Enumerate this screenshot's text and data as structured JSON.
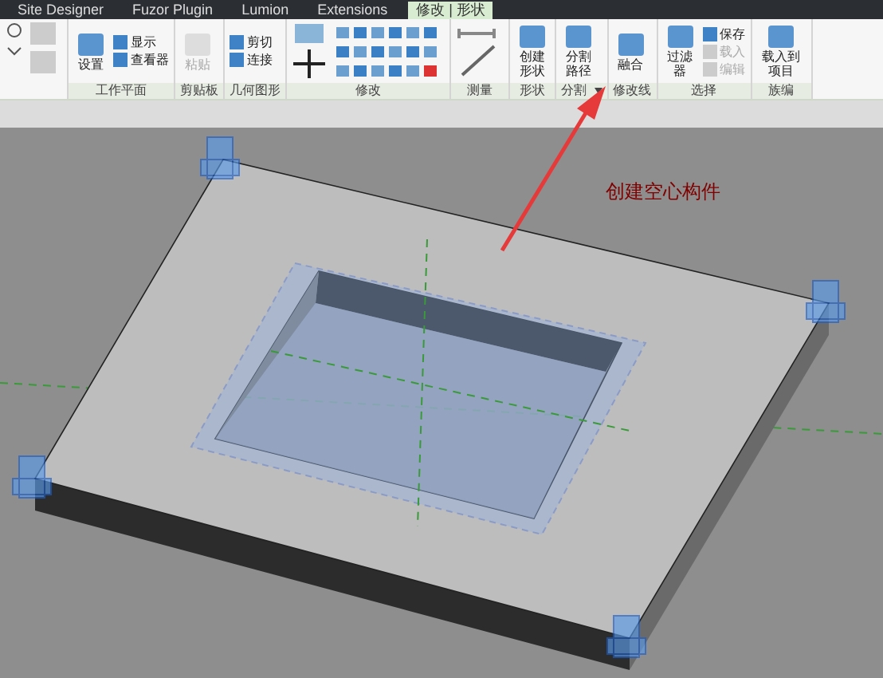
{
  "tabs": [
    {
      "label": "Site Designer",
      "selected": false
    },
    {
      "label": "Fuzor Plugin",
      "selected": false
    },
    {
      "label": "Lumion",
      "selected": false
    },
    {
      "label": "Extensions",
      "selected": false
    },
    {
      "label": "修改 | 形状",
      "selected": true
    }
  ],
  "panels": [
    {
      "label": "工作平面",
      "tools": [
        {
          "kind": "large",
          "label": "设置",
          "disabled": false
        },
        {
          "kind": "small",
          "label": "显示",
          "disabled": false
        },
        {
          "kind": "small",
          "label": "查看器",
          "disabled": false
        }
      ]
    },
    {
      "label": "剪贴板",
      "tools": [
        {
          "kind": "large",
          "label": "粘贴",
          "disabled": true
        }
      ]
    },
    {
      "label": "几何图形",
      "tools": [
        {
          "kind": "small",
          "label": "剪切",
          "disabled": false
        },
        {
          "kind": "small",
          "label": "连接",
          "disabled": false
        }
      ]
    },
    {
      "label": "修改"
    },
    {
      "label": "测量"
    },
    {
      "label": "形状",
      "tools": [
        {
          "kind": "large",
          "label": "创建形状",
          "disabled": false
        }
      ]
    },
    {
      "label": "分割",
      "dropdown": true,
      "tools": [
        {
          "kind": "large",
          "label": "分割路径",
          "disabled": false
        }
      ]
    },
    {
      "label": "修改线",
      "tools": [
        {
          "kind": "large",
          "label": "融合",
          "disabled": false
        }
      ]
    },
    {
      "label": "选择",
      "tools": [
        {
          "kind": "large",
          "label": "过滤器",
          "disabled": false
        },
        {
          "kind": "small",
          "label": "保存",
          "disabled": false
        },
        {
          "kind": "small",
          "label": "载入",
          "disabled": true
        },
        {
          "kind": "small",
          "label": "编辑",
          "disabled": true
        }
      ]
    },
    {
      "label": "族编",
      "tools": [
        {
          "kind": "large",
          "label": "载入到项目",
          "disabled": false
        }
      ]
    }
  ],
  "annotation": "创建空心构件"
}
